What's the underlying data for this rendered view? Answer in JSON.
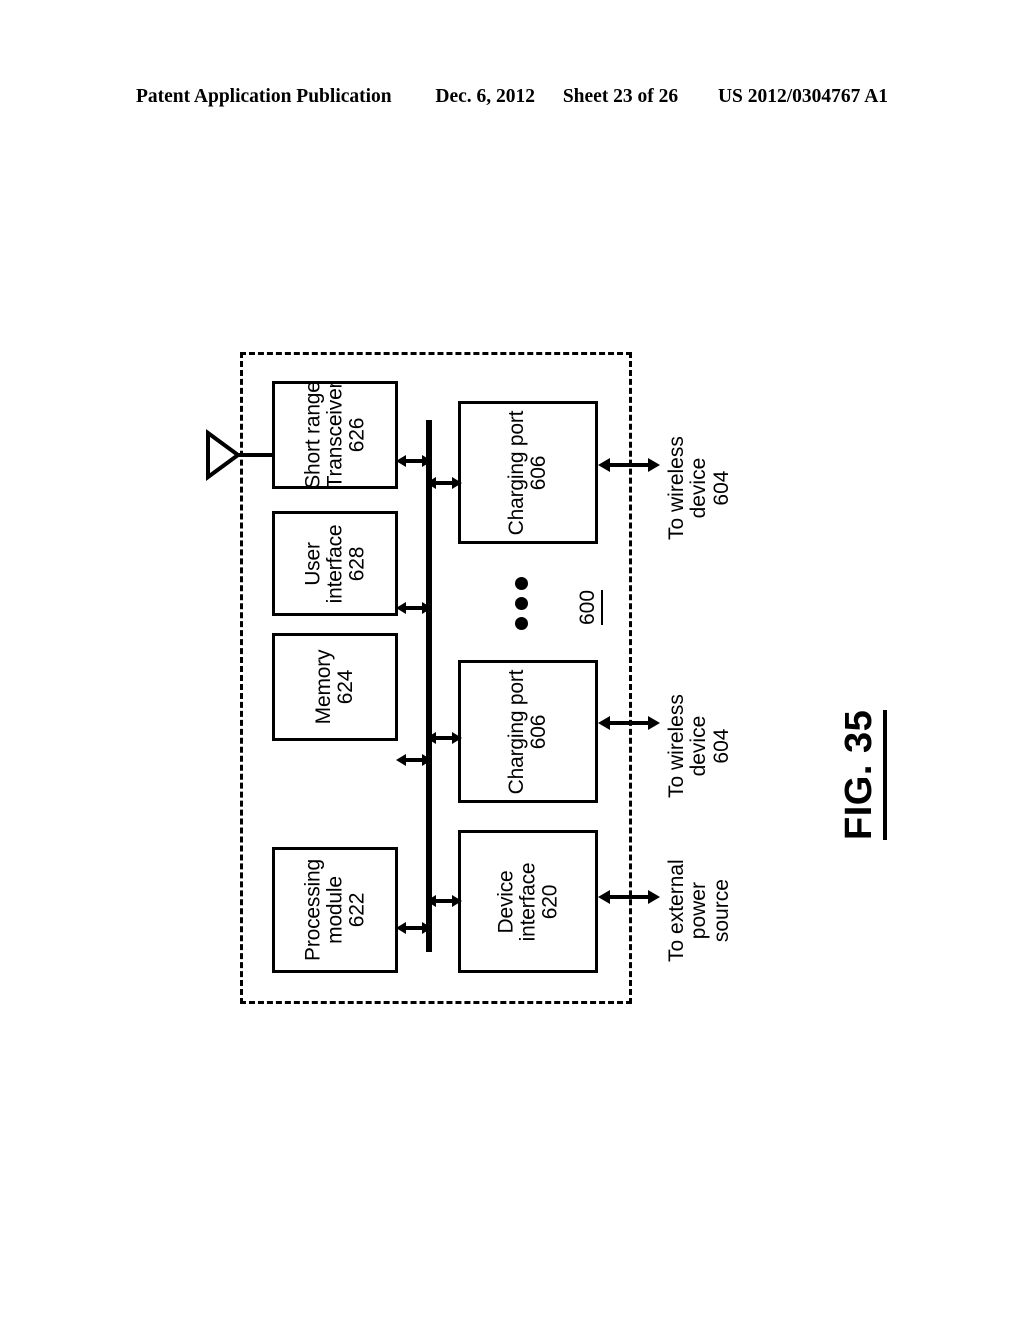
{
  "header": {
    "publication": "Patent Application Publication",
    "date": "Dec. 6, 2012",
    "sheet": "Sheet 23 of 26",
    "patent_number": "US 2012/0304767 A1"
  },
  "figure": {
    "caption": "FIG. 35",
    "system_ref": "600",
    "ellipsis": "vertical-ellipsis"
  },
  "blocks": {
    "short_range_transceiver": {
      "line1": "Short range",
      "line2": "Transceiver",
      "ref": "626"
    },
    "user_interface": {
      "line1": "User",
      "line2": "interface",
      "ref": "628"
    },
    "memory": {
      "line1": "Memory",
      "line2": "",
      "ref": "624"
    },
    "processing_module": {
      "line1": "Processing",
      "line2": "module",
      "ref": "622"
    },
    "charging_port_top": {
      "line1": "Charging port",
      "line2": "",
      "ref": "606"
    },
    "charging_port_bottom": {
      "line1": "Charging port",
      "line2": "",
      "ref": "606"
    },
    "device_interface": {
      "line1": "Device",
      "line2": "interface",
      "ref": "620"
    }
  },
  "external_labels": {
    "to_wireless_device_top": {
      "line1": "To wireless",
      "line2": "device",
      "ref": "604"
    },
    "to_wireless_device_bottom": {
      "line1": "To wireless",
      "line2": "device",
      "ref": "604"
    },
    "to_external_power_source": {
      "line1": "To external",
      "line2": "power",
      "line3": "source"
    }
  },
  "colors": {
    "ink": "#000000",
    "paper": "#ffffff"
  }
}
